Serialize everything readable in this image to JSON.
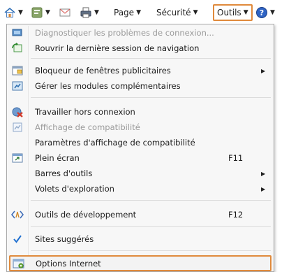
{
  "commandbar": {
    "page_label": "Page",
    "security_label": "Sécurité",
    "tools_label": "Outils",
    "icons": [
      "home-icon",
      "feeds-icon",
      "read-mail-icon",
      "print-icon",
      "help-icon"
    ]
  },
  "menu": {
    "items": [
      {
        "label": "Diagnostiquer les problèmes de connexion...",
        "icon": "network-diagnose-icon",
        "disabled": true
      },
      {
        "label": "Rouvrir la dernière session de navigation",
        "icon": "reopen-session-icon"
      },
      {
        "label": "Bloqueur de fenêtres publicitaires",
        "icon": "popup-blocker-icon",
        "submenu": true
      },
      {
        "label": "Gérer les modules complémentaires",
        "icon": "addons-icon"
      },
      {
        "label": "Travailler hors connexion",
        "icon": "work-offline-icon"
      },
      {
        "label": "Affichage de compatibilité",
        "icon": "compatibility-icon",
        "disabled": true
      },
      {
        "label": "Paramètres d'affichage de compatibilité"
      },
      {
        "label": "Plein écran",
        "icon": "fullscreen-icon",
        "shortcut": "F11"
      },
      {
        "label": "Barres d'outils",
        "submenu": true
      },
      {
        "label": "Volets d'exploration",
        "submenu": true
      },
      {
        "label": "Outils de développement",
        "icon": "developer-tools-icon",
        "shortcut": "F12"
      },
      {
        "label": "Sites suggérés",
        "icon": "checkmark-icon",
        "checked": true
      },
      {
        "label": "Options Internet",
        "icon": "internet-options-icon",
        "highlighted": true
      }
    ]
  },
  "colors": {
    "highlight_border": "#e08a3c",
    "menu_bg": "#f7f7f7",
    "disabled_text": "#9a9a9a",
    "check_blue": "#1e6fd0"
  }
}
